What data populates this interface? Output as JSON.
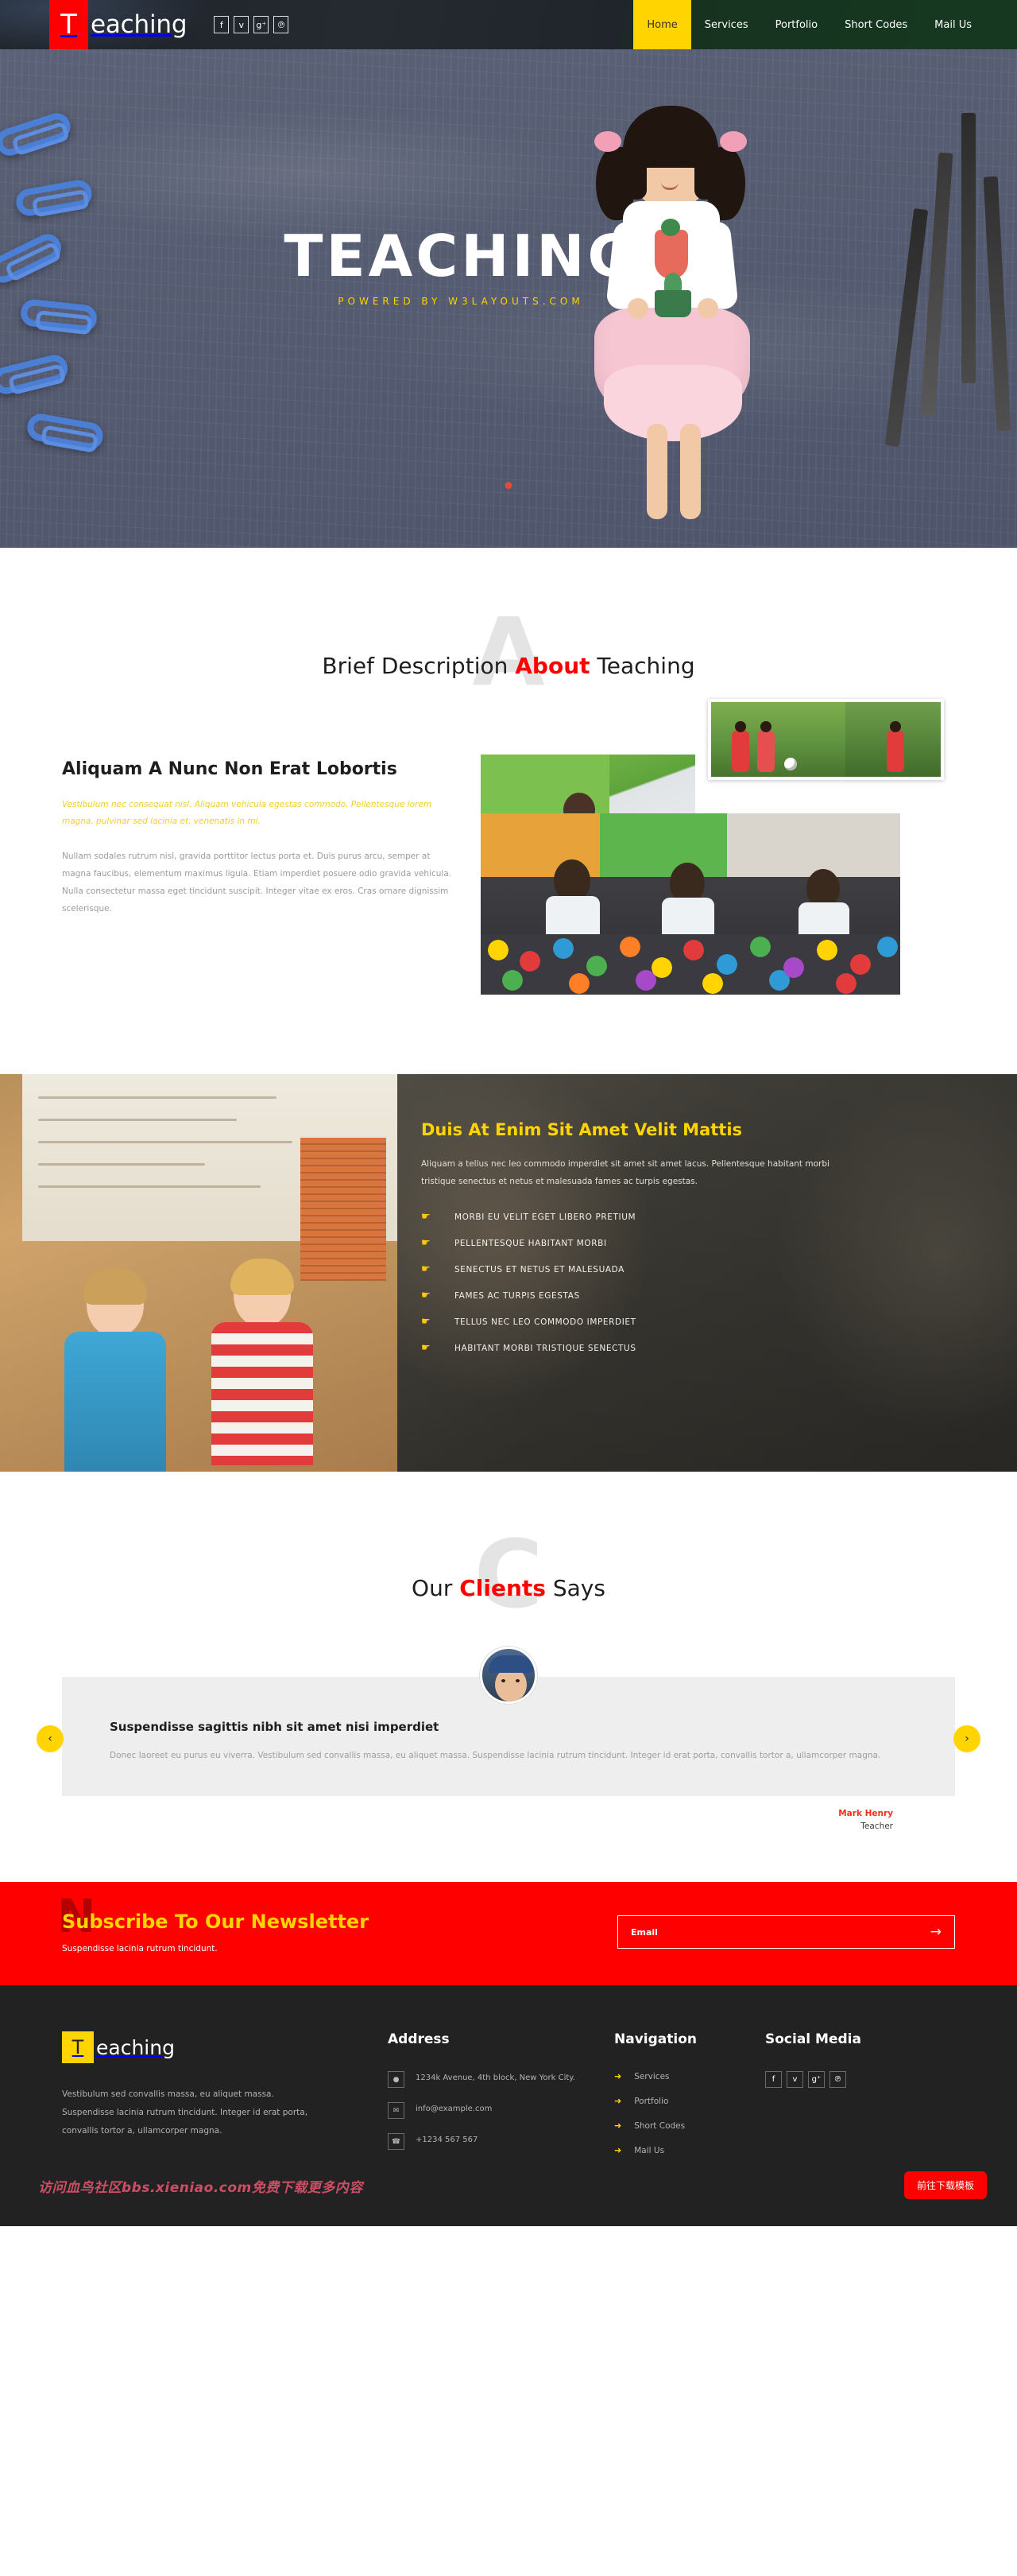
{
  "header": {
    "logo_initial": "T",
    "logo_text": "eaching",
    "social": [
      {
        "name": "facebook-icon",
        "glyph": "f"
      },
      {
        "name": "twitter-icon",
        "glyph": "ᴠ"
      },
      {
        "name": "google-plus-icon",
        "glyph": "g⁺"
      },
      {
        "name": "pinterest-icon",
        "glyph": "℗"
      }
    ],
    "nav": [
      {
        "label": "Home",
        "active": true
      },
      {
        "label": "Services",
        "active": false
      },
      {
        "label": "Portfolio",
        "active": false
      },
      {
        "label": "Short Codes",
        "active": false
      },
      {
        "label": "Mail Us",
        "active": false
      }
    ]
  },
  "hero": {
    "title": "TEACHING",
    "subtitle": "POWERED BY W3LAYOUTS.COM"
  },
  "about": {
    "watermark": "A",
    "title_pre": "Brief Description ",
    "title_hl": "About",
    "title_post": " Teaching",
    "heading": "Aliquam A Nunc Non Erat Lobortis",
    "yellow_text": "Vestibulum nec consequat nisl. Aliquam vehicula egestas commodo. Pellentesque lorem magna, pulvinar sed lacinia et, venenatis in mi.",
    "body_text": "Nullam sodales rutrum nisl, gravida porttitor lectus porta et. Duis purus arcu, semper at magna faucibus, elementum maximus ligula. Etiam imperdiet posuere odio gravida vehicula. Nulla consectetur massa eget tincidunt suscipit. Integer vitae ex eros. Cras ornare dignissim scelerisque."
  },
  "band": {
    "heading": "Duis At Enim Sit Amet Velit Mattis",
    "paragraph": "Aliquam a tellus nec leo commodo imperdiet sit amet sit amet lacus. Pellentesque habitant morbi tristique senectus et netus et malesuada fames ac turpis egestas.",
    "items": [
      "MORBI EU VELIT EGET LIBERO PRETIUM",
      "PELLENTESQUE HABITANT MORBI",
      "SENECTUS ET NETUS ET MALESUADA",
      "FAMES AC TURPIS EGESTAS",
      "TELLUS NEC LEO COMMODO IMPERDIET",
      "HABITANT MORBI TRISTIQUE SENECTUS"
    ]
  },
  "clients": {
    "watermark": "C",
    "title_pre": "Our ",
    "title_hl": "Clients",
    "title_post": " Says",
    "testimonial": {
      "heading": "Suspendisse sagittis nibh sit amet nisi imperdiet",
      "body": "Donec laoreet eu purus eu viverra. Vestibulum sed convallis massa, eu aliquet massa. Suspendisse lacinia rutrum tincidunt. Integer id erat porta, convallis tortor a, ullamcorper magna.",
      "author_name": "Mark Henry",
      "author_role": "Teacher"
    },
    "prev_glyph": "‹",
    "next_glyph": "›"
  },
  "newsletter": {
    "watermark": "N",
    "heading": "Subscribe To Our Newsletter",
    "subtext": "Suspendisse lacinia rutrum tincidunt.",
    "input_placeholder": "Email",
    "submit_glyph": "→"
  },
  "footer": {
    "logo_initial": "T",
    "logo_text": "eaching",
    "description": "Vestibulum sed convallis massa, eu aliquet massa. Suspendisse lacinia rutrum tincidunt. Integer id erat porta, convallis tortor a, ullamcorper magna.",
    "address_heading": "Address",
    "address_items": [
      {
        "icon": "location-pin-icon",
        "glyph": "●",
        "text": "1234k Avenue, 4th block, New York City."
      },
      {
        "icon": "envelope-icon",
        "glyph": "✉",
        "text": "info@example.com"
      },
      {
        "icon": "phone-icon",
        "glyph": "☎",
        "text": "+1234 567 567"
      }
    ],
    "nav_heading": "Navigation",
    "nav_items": [
      "Services",
      "Portfolio",
      "Short Codes",
      "Mail Us"
    ],
    "nav_arrow": "➜",
    "social_heading": "Social Media",
    "social": [
      {
        "name": "facebook-icon",
        "glyph": "f"
      },
      {
        "name": "twitter-icon",
        "glyph": "ᴠ"
      },
      {
        "name": "google-plus-icon",
        "glyph": "g⁺"
      },
      {
        "name": "pinterest-icon",
        "glyph": "℗"
      }
    ],
    "download_button": "前往下载模板",
    "watermark_cn": "访问血鸟社区bbs.xieniao.com免费下载更多内容"
  },
  "colors": {
    "red": "#ff0000",
    "yellow": "#ffd400",
    "dark": "#222222"
  }
}
